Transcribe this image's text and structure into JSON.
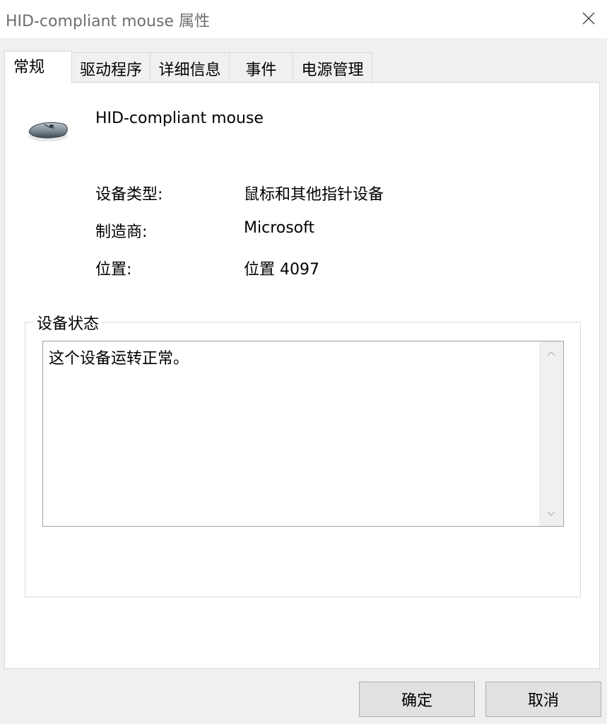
{
  "window": {
    "title": "HID-compliant mouse 属性"
  },
  "tabs": [
    {
      "label": "常规"
    },
    {
      "label": "驱动程序"
    },
    {
      "label": "详细信息"
    },
    {
      "label": "事件"
    },
    {
      "label": "电源管理"
    }
  ],
  "device": {
    "name": "HID-compliant mouse",
    "icon": "mouse-icon"
  },
  "properties": [
    {
      "label": "设备类型:",
      "value": "鼠标和其他指针设备"
    },
    {
      "label": "制造商:",
      "value": "Microsoft"
    },
    {
      "label": "位置:",
      "value": "位置 4097"
    }
  ],
  "status": {
    "legend": "设备状态",
    "text": "这个设备运转正常。"
  },
  "buttons": {
    "ok": "确定",
    "cancel": "取消"
  },
  "colors": {
    "title_text": "#6e6e6e",
    "panel_bg": "#ffffff",
    "window_bg": "#f0f0f0"
  }
}
